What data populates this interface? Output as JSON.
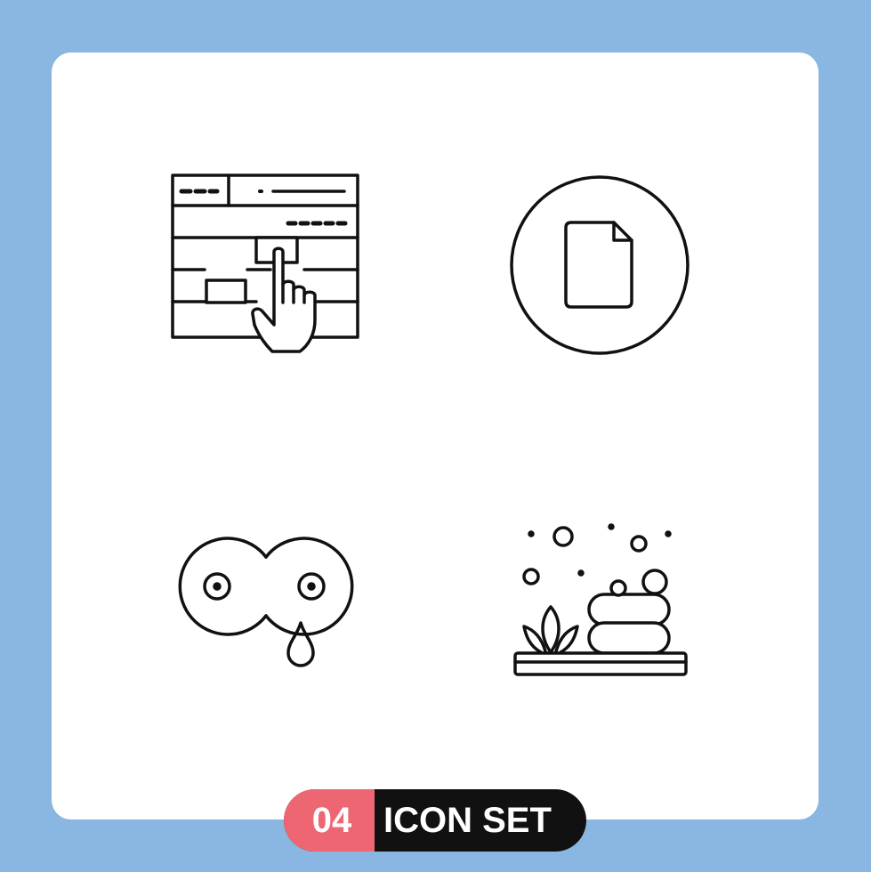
{
  "badge": {
    "number": "04",
    "title": "ICON SET",
    "number_color": "#ee6672",
    "title_bg_color": "#111111"
  },
  "colors": {
    "background": "#8ab6e2",
    "card": "#ffffff",
    "stroke": "#111111"
  },
  "icons": [
    {
      "name": "browser-click-icon"
    },
    {
      "name": "file-circle-icon"
    },
    {
      "name": "crying-eyes-icon"
    },
    {
      "name": "spa-soap-icon"
    }
  ]
}
